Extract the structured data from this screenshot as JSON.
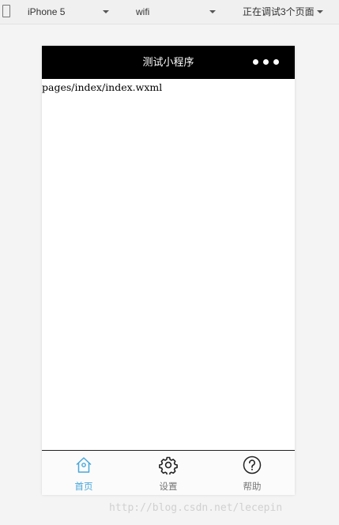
{
  "toolbar": {
    "device_select": "iPhone 5",
    "network_select": "wifi",
    "debug_select": "正在调试3个页面"
  },
  "navbar": {
    "title": "测试小程序",
    "more_icon": "ellipsis-icon"
  },
  "content": {
    "path_text": "pages/index/index.wxml"
  },
  "tabbar": {
    "items": [
      {
        "label": "首页",
        "icon": "home-icon",
        "active": true
      },
      {
        "label": "设置",
        "icon": "gear-icon",
        "active": false
      },
      {
        "label": "帮助",
        "icon": "help-icon",
        "active": false
      }
    ],
    "active_color": "#4aa7da",
    "inactive_color": "#777777"
  },
  "watermark": "http://blog.csdn.net/lecepin"
}
